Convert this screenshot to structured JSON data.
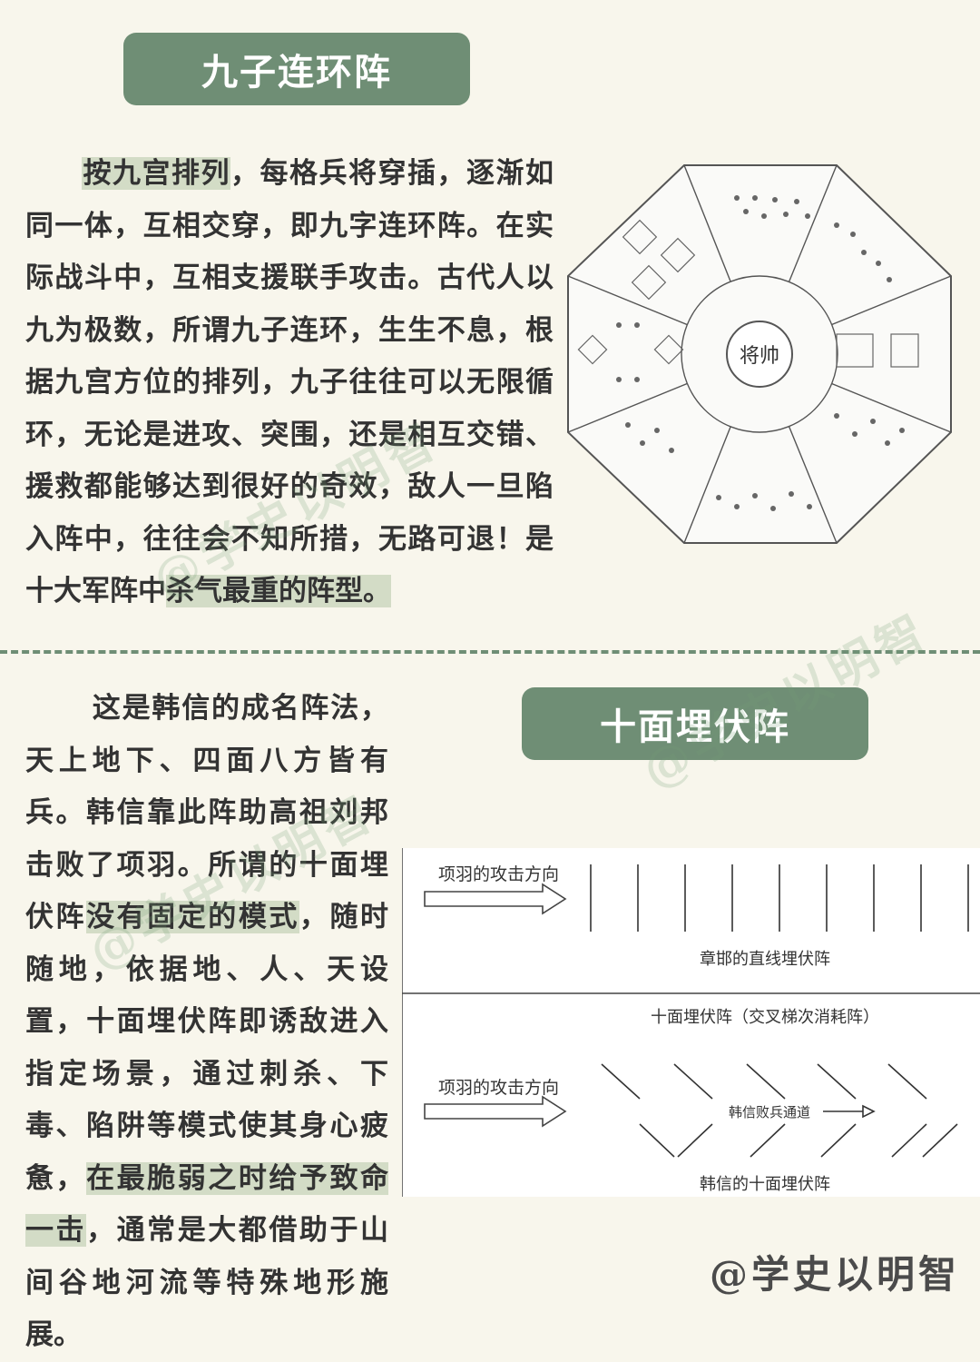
{
  "section1": {
    "title": "九子连环阵",
    "paragraph": {
      "highlight_start": "按九宫排列",
      "middle": "，每格兵将穿插，逐渐如同一体，互相交穿，即九字连环阵。在实际战斗中，互相支援联手攻击。古代人以九为极数，所谓九子连环，生生不息，根据九宫方位的排列，九子往往可以无限循环，无论是进攻、突围，还是相互交错、援救都能够达到很好的奇效，敌人一旦陷入阵中，往往会不知所措，无路可退！是十大军阵中",
      "highlight_end": "杀气最重的阵型。"
    },
    "figure": {
      "center_label": "将帅"
    }
  },
  "section2": {
    "title": "十面埋伏阵",
    "paragraph": {
      "part1": "这是韩信的成名阵法，天上地下、四面八方皆有兵。韩信靠此阵助高祖刘邦击败了项羽。所谓的十面埋伏阵",
      "highlight1": "没有固定的模式",
      "part2": "，随时随地，依据地、人、天设置，十面埋伏阵即诱敌进入指定场景，通过刺杀、下毒、陷阱等模式使其身心疲惫，",
      "highlight2": "在最脆弱之时给予致命一击",
      "part3": "，通常是大都借助于山间谷地河流等特殊地形施展。"
    },
    "figure": {
      "top_arrow_label": "项羽的攻击方向",
      "top_caption": "章邯的直线埋伏阵",
      "bottom_title": "十面埋伏阵（交叉梯次消耗阵）",
      "bottom_arrow_label": "项羽的攻击方向",
      "retreat_label": "韩信败兵通道",
      "bottom_caption": "韩信的十面埋伏阵"
    }
  },
  "watermark": "@学史以明智",
  "colors": {
    "accent": "#6f8e75",
    "highlight": "#d3dcc6",
    "background": "#f8f6ec"
  }
}
